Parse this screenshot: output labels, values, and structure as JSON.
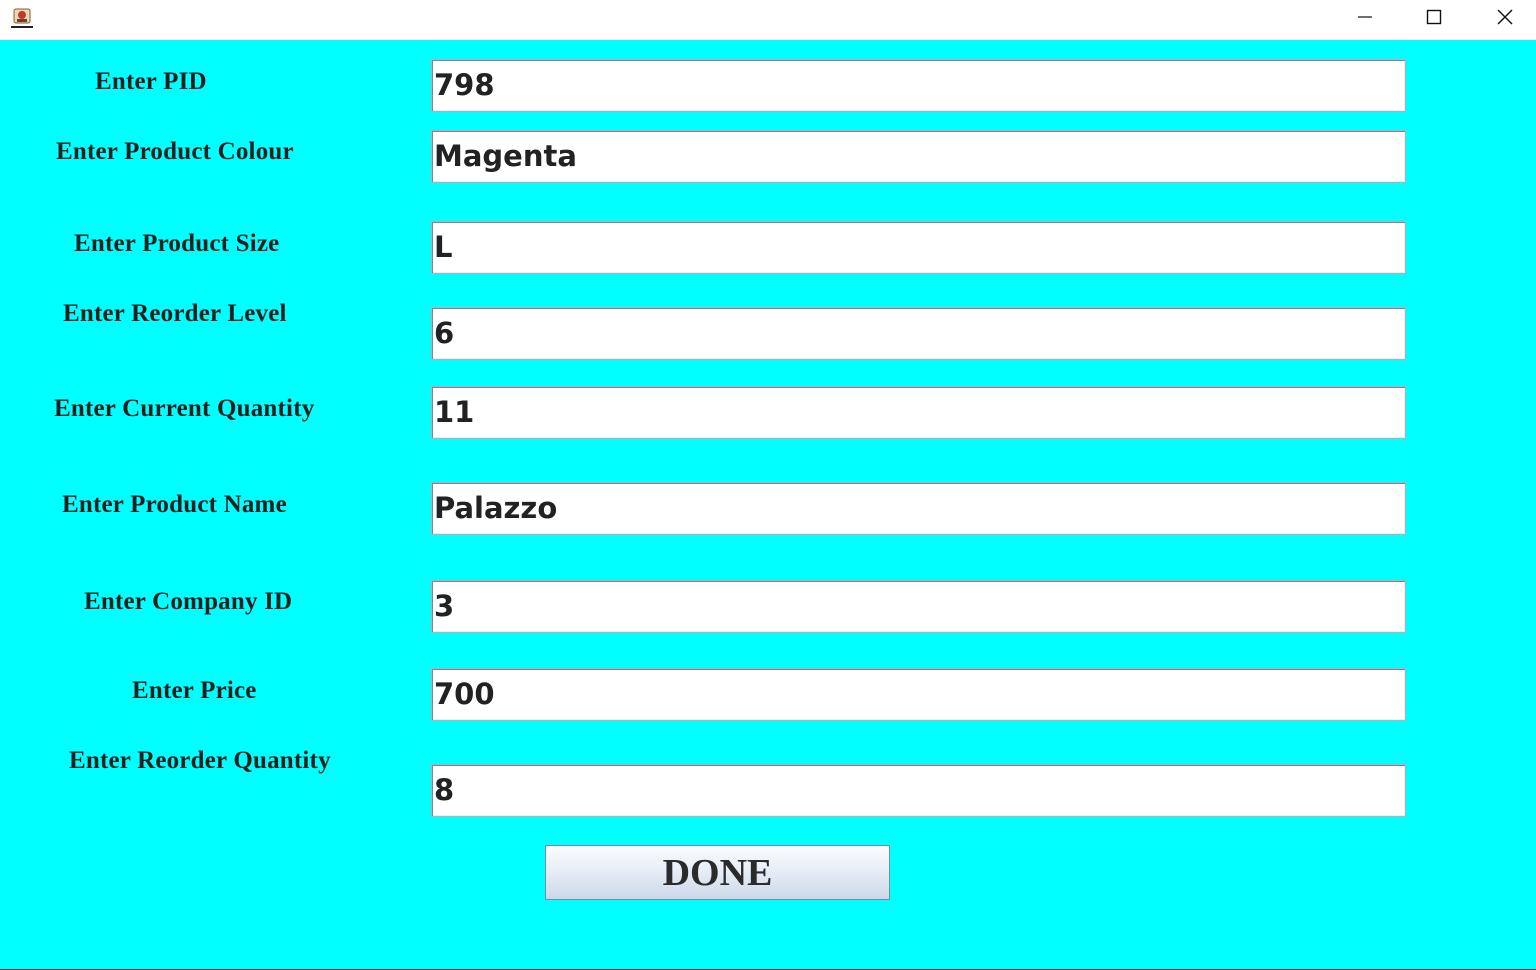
{
  "window": {
    "controls": {
      "minimize_icon": "minimize-icon",
      "maximize_icon": "maximize-icon",
      "close_icon": "close-icon"
    },
    "background_color": "#00ffff"
  },
  "form": {
    "pid": {
      "label": "Enter PID",
      "value": "798"
    },
    "colour": {
      "label": "Enter Product Colour",
      "value": "Magenta"
    },
    "size": {
      "label": "Enter Product Size",
      "value": "L"
    },
    "reorder_level": {
      "label": "Enter Reorder Level",
      "value": "6"
    },
    "current_quantity": {
      "label": "Enter Current Quantity",
      "value": "11"
    },
    "product_name": {
      "label": "Enter Product Name",
      "value": "Palazzo"
    },
    "company_id": {
      "label": "Enter Company ID",
      "value": "3"
    },
    "price": {
      "label": "Enter Price",
      "value": "700"
    },
    "reorder_quantity": {
      "label": "Enter Reorder Quantity",
      "value": "8"
    }
  },
  "done_button": {
    "label": "DONE"
  }
}
